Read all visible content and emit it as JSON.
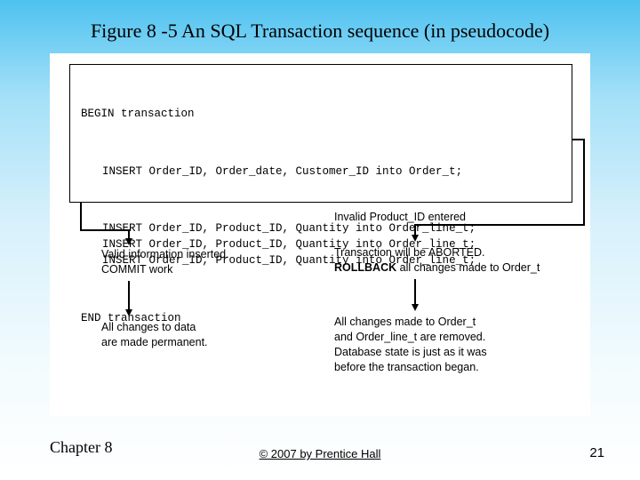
{
  "title": "Figure 8 -5 An SQL Transaction sequence (in pseudocode)",
  "code": {
    "begin": "BEGIN transaction",
    "insert_order": "INSERT Order_ID, Order_date, Customer_ID into Order_t;",
    "insert_line1": "INSERT Order_ID, Product_ID, Quantity into Order_line_t;",
    "insert_line2": "INSERT Order_ID, Product_ID, Quantity into Order_line_t;",
    "insert_line3": "INSERT Order_ID, Product_ID, Quantity into Order_line_t;",
    "end": "END transaction"
  },
  "left": {
    "valid1": "Valid information inserted.",
    "valid2": "COMMIT work",
    "perm1": "All changes to data",
    "perm2": "are made permanent."
  },
  "right": {
    "invalid": "Invalid Product_ID entered",
    "abort1": "Transaction will be ABORTED.",
    "abort2_a": "ROLLBACK",
    "abort2_b": " all changes made to Order_t",
    "removed1": "All changes made to Order_t",
    "removed2": "and Order_line_t are removed.",
    "removed3": "Database state is just as it was",
    "removed4": "before the transaction began."
  },
  "footer": {
    "chapter": "Chapter 8",
    "copyright": "© 2007 by Prentice Hall",
    "page": "21"
  }
}
